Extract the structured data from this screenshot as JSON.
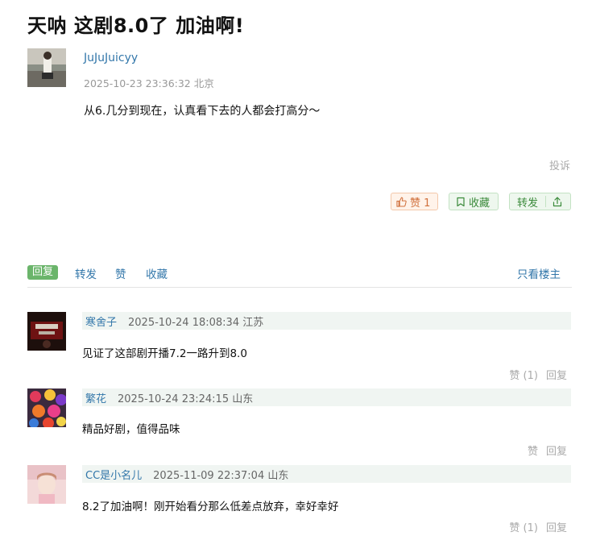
{
  "post": {
    "title": "天呐 这剧8.0了 加油啊!",
    "author": "JuJuJuicyy",
    "meta": "2025-10-23 23:36:32 北京",
    "content": "从6.几分到现在，认真看下去的人都会打高分～",
    "report_label": "投诉",
    "like_label": "赞 1",
    "fav_label": "收藏",
    "share_label": "转发"
  },
  "tabs": {
    "reply": "回复",
    "repost": "转发",
    "like": "赞",
    "fav": "收藏",
    "only_op": "只看楼主"
  },
  "comments": [
    {
      "user": "寒舍子",
      "meta": "2025-10-24 18:08:34 江苏",
      "text": "见证了这部剧开播7.2一路升到8.0",
      "like_label": "赞 (1)",
      "reply_label": "回复"
    },
    {
      "user": "繁花",
      "meta": "2025-10-24 23:24:15 山东",
      "text": "精品好剧，值得品味",
      "like_label": "赞",
      "reply_label": "回复"
    },
    {
      "user": "CC是小名儿",
      "meta": "2025-11-09 22:37:04 山东",
      "text": "8.2了加油啊！刚开始看分那么低差点放弃，幸好幸好",
      "like_label": "赞 (1)",
      "reply_label": "回复"
    }
  ],
  "colors": {
    "link": "#3377aa",
    "reply_tab_bg": "#6bb56b",
    "comment_head_bg": "#f0f5f2",
    "like_btn_bg": "#fff3ea"
  }
}
